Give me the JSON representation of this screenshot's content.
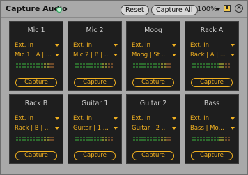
{
  "window": {
    "title": "Capture Audio",
    "reset_label": "Reset",
    "capture_all_label": "Capture All",
    "zoom": "100%",
    "close_glyph": "✕"
  },
  "channels": [
    {
      "name": "Mic 1",
      "input": "Ext. In",
      "route": "Mic 1 | A | ...",
      "capture_label": "Capture"
    },
    {
      "name": "Mic 2",
      "input": "Ext. In",
      "route": "Mic 2 | B | ...",
      "capture_label": "Capture"
    },
    {
      "name": "Moog",
      "input": "Ext. In",
      "route": "Moog | St ...",
      "capture_label": "Capture"
    },
    {
      "name": "Rack A",
      "input": "Ext. In",
      "route": "Rack | A | ...",
      "capture_label": "Capture"
    },
    {
      "name": "Rack B",
      "input": "Ext. In",
      "route": "Rack | B | ...",
      "capture_label": "Capture"
    },
    {
      "name": "Guitar 1",
      "input": "Ext. In",
      "route": "Guitar | 1 ...",
      "capture_label": "Capture"
    },
    {
      "name": "Guitar 2",
      "input": "Ext. In",
      "route": "Guitar | 2 ...",
      "capture_label": "Capture"
    },
    {
      "name": "Bass",
      "input": "Ext. In",
      "route": "Bass | Mo...",
      "capture_label": "Capture"
    }
  ],
  "colors": {
    "accent": "#f0b020",
    "card_bg": "#1e1e1e",
    "window_bg": "#a9a9a9"
  }
}
